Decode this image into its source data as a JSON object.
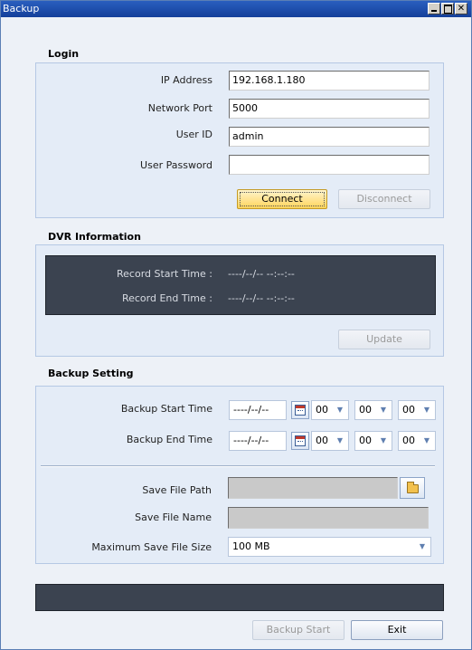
{
  "window": {
    "title": "Backup"
  },
  "login": {
    "section_title": "Login",
    "ip_label": "IP Address",
    "ip_value": "192.168.1.180",
    "port_label": "Network Port",
    "port_value": "5000",
    "user_label": "User ID",
    "user_value": "admin",
    "password_label": "User Password",
    "password_value": "",
    "connect_label": "Connect",
    "disconnect_label": "Disconnect"
  },
  "dvr": {
    "section_title": "DVR Information",
    "start_label": "Record Start Time :",
    "start_value": "----/--/-- --:--:--",
    "end_label": "Record End Time :",
    "end_value": "----/--/-- --:--:--",
    "update_label": "Update"
  },
  "backup": {
    "section_title": "Backup Setting",
    "start_label": "Backup Start Time",
    "start_date": "----/--/--",
    "start_hh": "00",
    "start_mm": "00",
    "start_ss": "00",
    "end_label": "Backup End Time",
    "end_date": "----/--/--",
    "end_hh": "00",
    "end_mm": "00",
    "end_ss": "00",
    "path_label": "Save File Path",
    "path_value": "",
    "name_label": "Save File Name",
    "name_value": "",
    "size_label": "Maximum Save File Size",
    "size_value": "100 MB"
  },
  "footer": {
    "status_text": "",
    "backup_start_label": "Backup Start",
    "exit_label": "Exit"
  },
  "colors": {
    "title_bar": "#1c4aa8",
    "panel": "#e4ecf7",
    "dark_box": "#3b4350",
    "connect_button": "#ffd45a"
  },
  "icons": {
    "calendar": "calendar-icon",
    "folder": "folder-icon",
    "dropdown": "chevron-down-icon"
  }
}
